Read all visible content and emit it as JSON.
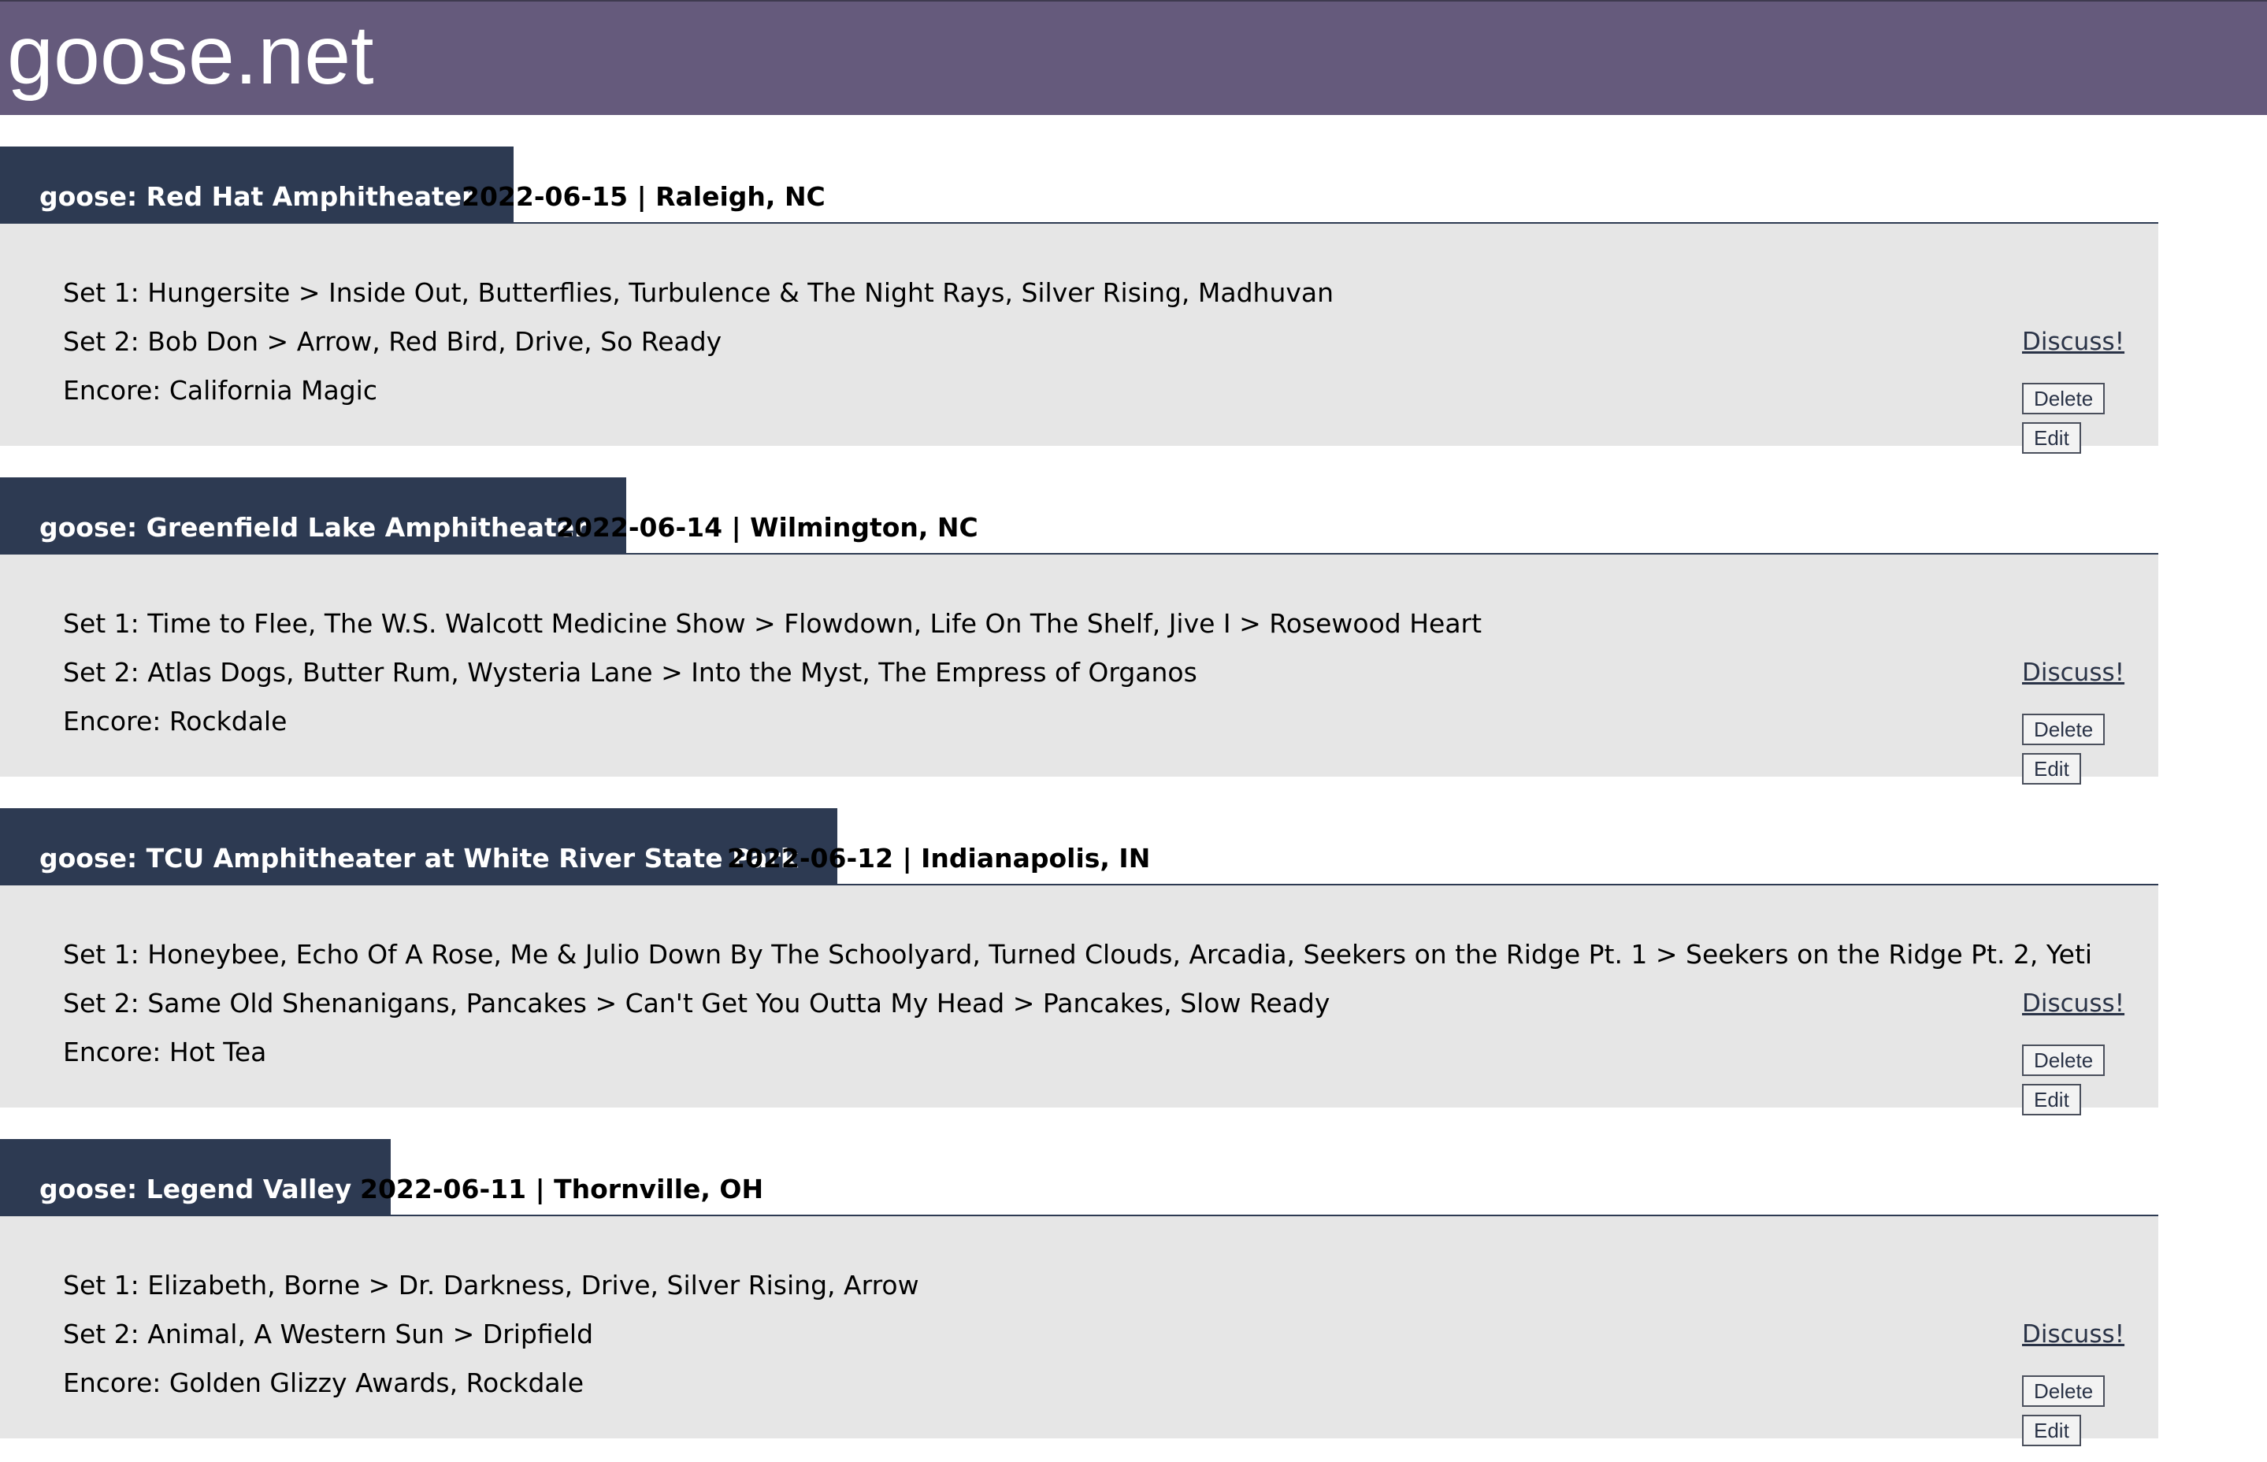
{
  "site": {
    "title": "goose.net"
  },
  "shows": [
    {
      "venue": "goose: Red Hat Amphitheater",
      "date_location": "2022-06-15 | Raleigh, NC",
      "sets": [
        "Set 1: Hungersite > Inside Out, Butterflies, Turbulence & The Night Rays, Silver Rising, Madhuvan",
        "Set 2: Bob Don > Arrow, Red Bird, Drive, So Ready",
        "Encore: California Magic"
      ],
      "discuss_label": "Discuss!",
      "delete_label": "Delete",
      "edit_label": "Edit"
    },
    {
      "venue": "goose: Greenfield Lake Amphitheater",
      "date_location": "2022-06-14 | Wilmington, NC",
      "sets": [
        "Set 1: Time to Flee, The W.S. Walcott Medicine Show > Flowdown, Life On The Shelf, Jive I > Rosewood Heart",
        "Set 2: Atlas Dogs, Butter Rum, Wysteria Lane > Into the Myst, The Empress of Organos",
        "Encore: Rockdale"
      ],
      "discuss_label": "Discuss!",
      "delete_label": "Delete",
      "edit_label": "Edit"
    },
    {
      "venue": "goose: TCU Amphitheater at White River State Park",
      "date_location": "2022-06-12 | Indianapolis, IN",
      "sets": [
        "Set 1: Honeybee, Echo Of A Rose, Me & Julio Down By The Schoolyard, Turned Clouds, Arcadia, Seekers on the Ridge Pt. 1 > Seekers on the Ridge Pt. 2, Yeti",
        "Set 2: Same Old Shenanigans, Pancakes > Can't Get You Outta My Head > Pancakes, Slow Ready",
        "Encore: Hot Tea"
      ],
      "discuss_label": "Discuss!",
      "delete_label": "Delete",
      "edit_label": "Edit"
    },
    {
      "venue": "goose: Legend Valley",
      "date_location": "2022-06-11 | Thornville, OH",
      "sets": [
        "Set 1: Elizabeth, Borne > Dr. Darkness, Drive, Silver Rising, Arrow",
        "Set 2: Animal, A Western Sun > Dripfield",
        "Encore: Golden Glizzy Awards, Rockdale"
      ],
      "discuss_label": "Discuss!",
      "delete_label": "Delete",
      "edit_label": "Edit"
    }
  ]
}
